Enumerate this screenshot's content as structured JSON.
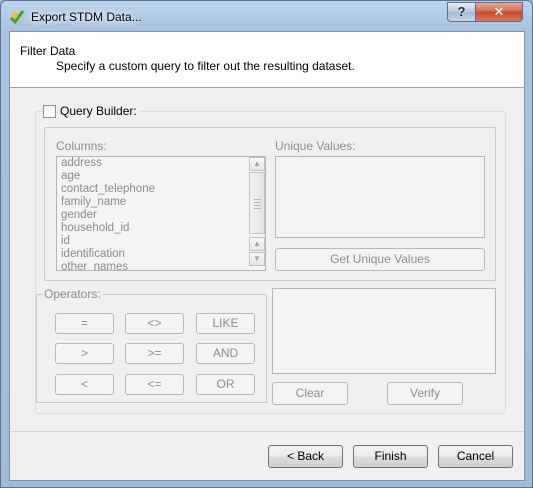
{
  "window": {
    "title": "Export STDM Data...",
    "help_label": "?",
    "close_label": "✕",
    "icon": "qgis-icon"
  },
  "header": {
    "title": "Filter Data",
    "subtitle": "Specify a custom query to filter out the resulting dataset."
  },
  "query_builder": {
    "label": "Query Builder:",
    "checked": false,
    "columns_label": "Columns:",
    "columns": [
      "address",
      "age",
      "contact_telephone",
      "family_name",
      "gender",
      "household_id",
      "id",
      "identification",
      "other_names"
    ],
    "unique_values_label": "Unique Values:",
    "get_unique_values_label": "Get Unique Values",
    "operators_label": "Operators:",
    "operators": [
      [
        "=",
        "<>",
        "LIKE"
      ],
      [
        ">",
        ">=",
        "AND"
      ],
      [
        "<",
        "<=",
        "OR"
      ]
    ],
    "clear_label": "Clear",
    "verify_label": "Verify"
  },
  "footer": {
    "back_label": "< Back",
    "finish_label": "Finish",
    "cancel_label": "Cancel"
  }
}
